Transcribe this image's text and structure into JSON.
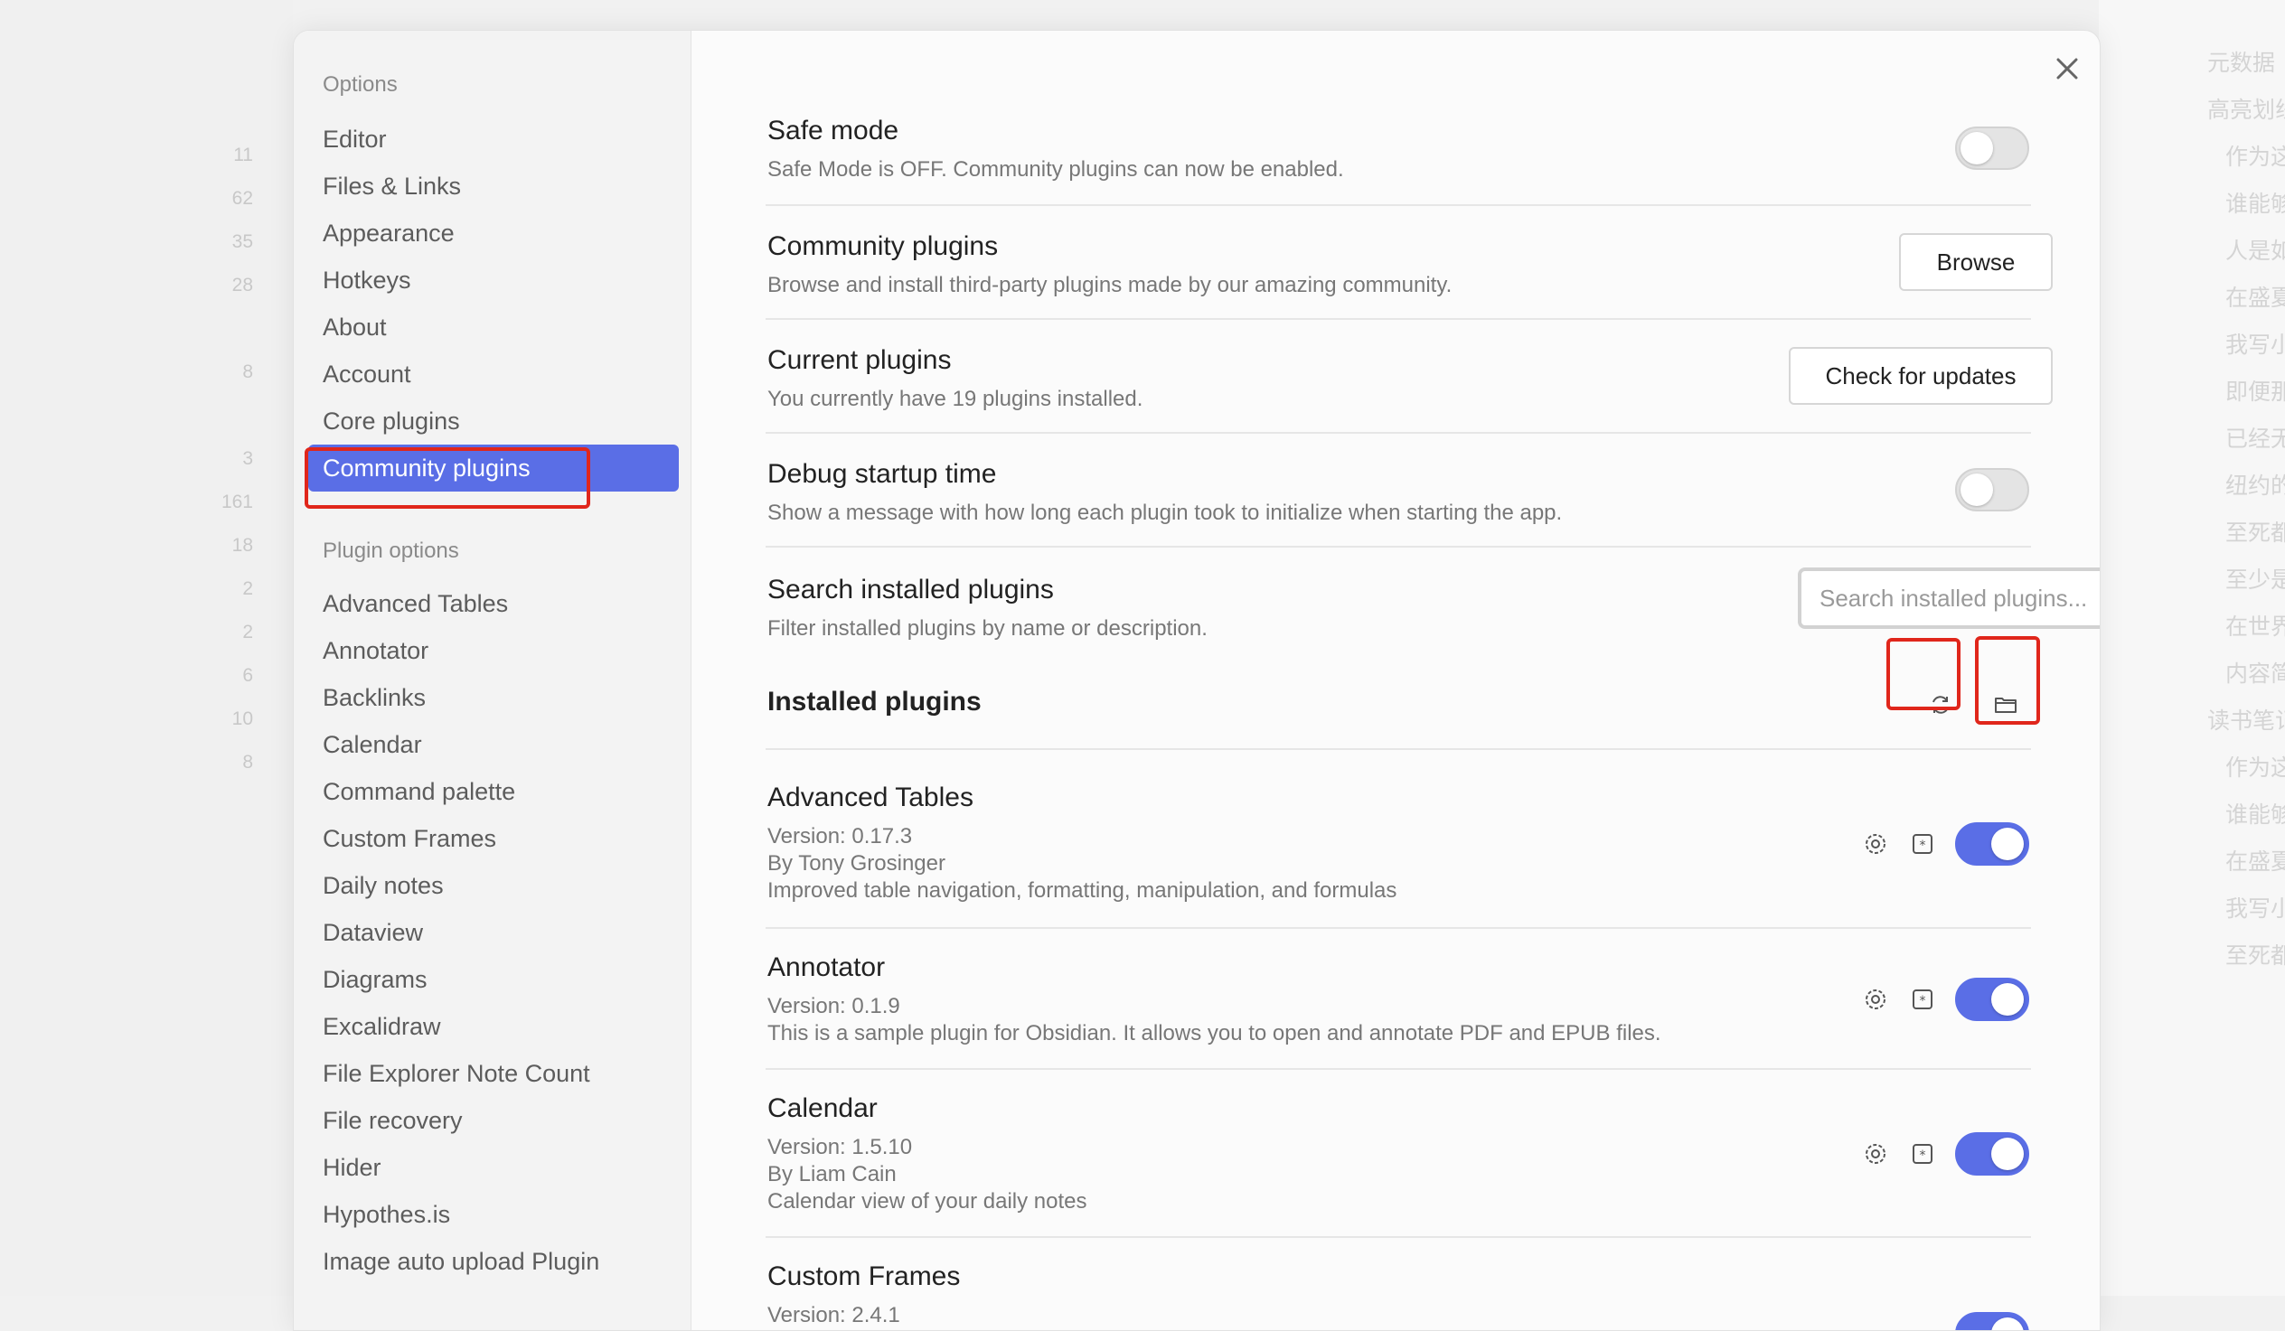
{
  "background": {
    "line_numbers": [
      "11",
      "62",
      "35",
      "28",
      "8",
      "3",
      "161",
      "18",
      "2",
      "2",
      "6",
      "10",
      "8"
    ],
    "right_lines": [
      "元数据",
      "高亮划线",
      "作为这",
      "谁能够",
      "人是如",
      "在盛夏",
      "我写小",
      "即便那",
      "已经无",
      "纽约的",
      "至死都",
      "至少是",
      "在世界",
      "内容简",
      "读书笔记",
      "作为这",
      "谁能够",
      "在盛夏",
      "我写小",
      "至死都"
    ]
  },
  "sidebar": {
    "options_heading": "Options",
    "options": [
      "Editor",
      "Files & Links",
      "Appearance",
      "Hotkeys",
      "About",
      "Account",
      "Core plugins",
      "Community plugins"
    ],
    "active_index": 7,
    "plugin_options_heading": "Plugin options",
    "plugin_options": [
      "Advanced Tables",
      "Annotator",
      "Backlinks",
      "Calendar",
      "Command palette",
      "Custom Frames",
      "Daily notes",
      "Dataview",
      "Diagrams",
      "Excalidraw",
      "File Explorer Note Count",
      "File recovery",
      "Hider",
      "Hypothes.is",
      "Image auto upload Plugin"
    ]
  },
  "settings": {
    "safe_mode": {
      "title": "Safe mode",
      "desc": "Safe Mode is OFF. Community plugins can now be enabled.",
      "enabled": false
    },
    "community": {
      "title": "Community plugins",
      "desc": "Browse and install third-party plugins made by our amazing community.",
      "button": "Browse"
    },
    "current": {
      "title": "Current plugins",
      "desc": "You currently have 19 plugins installed.",
      "button": "Check for updates"
    },
    "debug": {
      "title": "Debug startup time",
      "desc": "Show a message with how long each plugin took to initialize when starting the app.",
      "enabled": false
    },
    "search": {
      "title": "Search installed plugins",
      "desc": "Filter installed plugins by name or description.",
      "placeholder": "Search installed plugins..."
    },
    "installed_heading": "Installed plugins"
  },
  "plugins": [
    {
      "name": "Advanced Tables",
      "version": "Version: 0.17.3",
      "author": "By Tony Grosinger",
      "desc": "Improved table navigation, formatting, manipulation, and formulas",
      "enabled": true
    },
    {
      "name": "Annotator",
      "version": "Version: 0.1.9",
      "desc": "This is a sample plugin for Obsidian. It allows you to open and annotate PDF and EPUB files.",
      "enabled": true
    },
    {
      "name": "Calendar",
      "version": "Version: 1.5.10",
      "author": "By Liam Cain",
      "desc": "Calendar view of your daily notes",
      "enabled": true
    },
    {
      "name": "Custom Frames",
      "version": "Version: 2.4.1",
      "enabled": true
    }
  ],
  "colors": {
    "accent": "#5a6ee6",
    "highlight": "#e0261b"
  },
  "icons": {
    "close": "close-icon",
    "reload": "reload-icon",
    "folder": "folder-icon",
    "settings": "gear-icon",
    "hotkeys": "hotkey-icon",
    "uninstall": "x-icon"
  }
}
